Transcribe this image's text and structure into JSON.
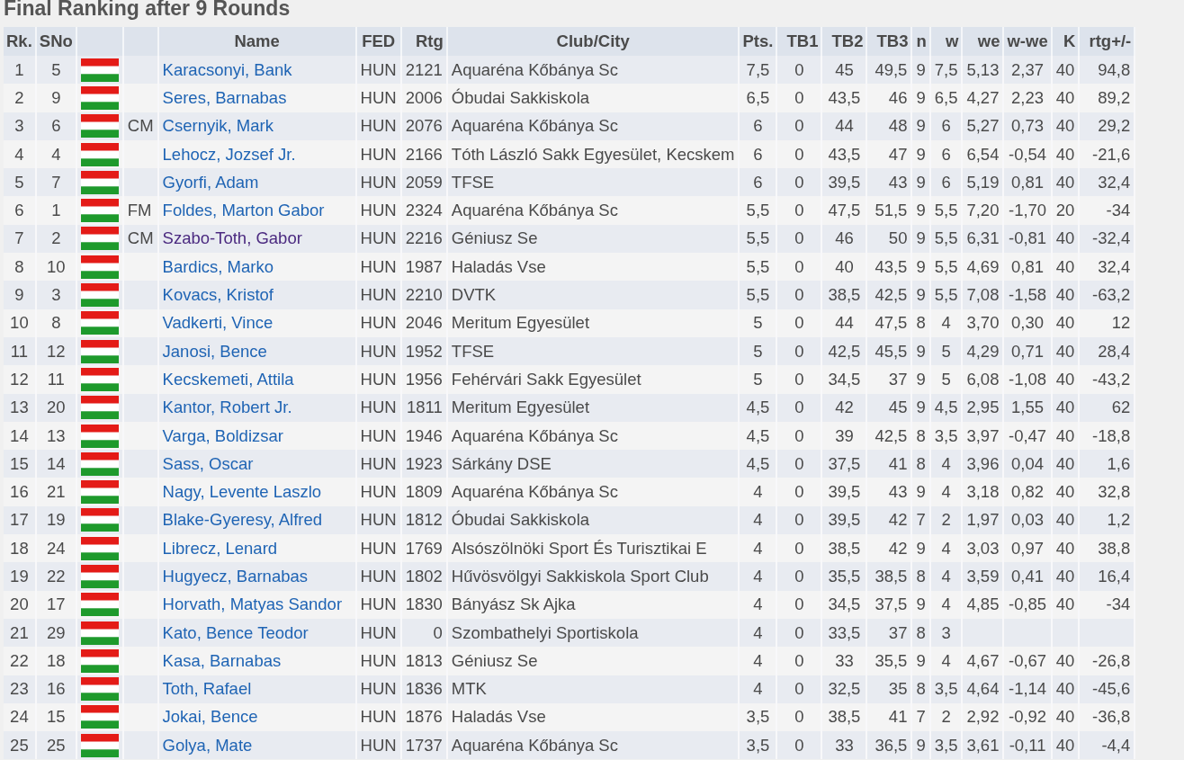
{
  "title": "Final Ranking after 9 Rounds",
  "table": {
    "columns": [
      "Rk.",
      "SNo",
      "Name",
      "FED",
      "Rtg",
      "Club/City",
      "Pts.",
      "TB1",
      "TB2",
      "TB3",
      "n",
      "w",
      "we",
      "w-we",
      "K",
      "rtg+/-"
    ],
    "rows": [
      {
        "rank": "1",
        "sno": "5",
        "name": "Karacsonyi, Bank",
        "visited": false,
        "fed": "HUN",
        "rtg": "2121",
        "club": "Aquaréna Kőbánya Sc",
        "pts": "7,5",
        "tb1": "0",
        "tb2": "45",
        "tb3": "49,5",
        "n": "9",
        "w": "7,5",
        "we": "5,13",
        "w_we": "2,37",
        "k": "40",
        "rtg_diff": "94,8"
      },
      {
        "rank": "2",
        "sno": "9",
        "name": "Seres, Barnabas",
        "visited": false,
        "fed": "HUN",
        "rtg": "2006",
        "club": "Óbudai Sakkiskola",
        "pts": "6,5",
        "tb1": "0",
        "tb2": "43,5",
        "tb3": "46",
        "n": "9",
        "w": "6,5",
        "we": "4,27",
        "w_we": "2,23",
        "k": "40",
        "rtg_diff": "89,2"
      },
      {
        "rank": "3",
        "sno": "6",
        "title": "CM",
        "name": "Csernyik, Mark",
        "visited": false,
        "fed": "HUN",
        "rtg": "2076",
        "club": "Aquaréna Kőbánya Sc",
        "pts": "6",
        "tb1": "0",
        "tb2": "44",
        "tb3": "48",
        "n": "9",
        "w": "6",
        "we": "5,27",
        "w_we": "0,73",
        "k": "40",
        "rtg_diff": "29,2"
      },
      {
        "rank": "4",
        "sno": "4",
        "name": "Lehocz, Jozsef Jr.",
        "visited": false,
        "fed": "HUN",
        "rtg": "2166",
        "club": "Tóth László Sakk Egyesület, Kecskem",
        "pts": "6",
        "tb1": "0",
        "tb2": "43,5",
        "tb3": "47",
        "n": "9",
        "w": "6",
        "we": "6,54",
        "w_we": "-0,54",
        "k": "40",
        "rtg_diff": "-21,6"
      },
      {
        "rank": "5",
        "sno": "7",
        "name": "Gyorfi, Adam",
        "visited": false,
        "fed": "HUN",
        "rtg": "2059",
        "club": "TFSE",
        "pts": "6",
        "tb1": "0",
        "tb2": "39,5",
        "tb3": "43",
        "n": "9",
        "w": "6",
        "we": "5,19",
        "w_we": "0,81",
        "k": "40",
        "rtg_diff": "32,4"
      },
      {
        "rank": "6",
        "sno": "1",
        "title": "FM",
        "name": "Foldes, Marton Gabor",
        "visited": false,
        "fed": "HUN",
        "rtg": "2324",
        "club": "Aquaréna Kőbánya Sc",
        "pts": "5,5",
        "tb1": "0",
        "tb2": "47,5",
        "tb3": "51,5",
        "n": "9",
        "w": "5,5",
        "we": "7,20",
        "w_we": "-1,70",
        "k": "20",
        "rtg_diff": "-34"
      },
      {
        "rank": "7",
        "sno": "2",
        "title": "CM",
        "name": "Szabo-Toth, Gabor",
        "visited": true,
        "fed": "HUN",
        "rtg": "2216",
        "club": "Géniusz Se",
        "pts": "5,5",
        "tb1": "0",
        "tb2": "46",
        "tb3": "50",
        "n": "9",
        "w": "5,5",
        "we": "6,31",
        "w_we": "-0,81",
        "k": "40",
        "rtg_diff": "-32,4"
      },
      {
        "rank": "8",
        "sno": "10",
        "name": "Bardics, Marko",
        "visited": false,
        "fed": "HUN",
        "rtg": "1987",
        "club": "Haladás Vse",
        "pts": "5,5",
        "tb1": "0",
        "tb2": "40",
        "tb3": "43,5",
        "n": "9",
        "w": "5,5",
        "we": "4,69",
        "w_we": "0,81",
        "k": "40",
        "rtg_diff": "32,4"
      },
      {
        "rank": "9",
        "sno": "3",
        "name": "Kovacs, Kristof",
        "visited": false,
        "fed": "HUN",
        "rtg": "2210",
        "club": "DVTK",
        "pts": "5,5",
        "tb1": "0",
        "tb2": "38,5",
        "tb3": "42,5",
        "n": "9",
        "w": "5,5",
        "we": "7,08",
        "w_we": "-1,58",
        "k": "40",
        "rtg_diff": "-63,2"
      },
      {
        "rank": "10",
        "sno": "8",
        "name": "Vadkerti, Vince",
        "visited": false,
        "fed": "HUN",
        "rtg": "2046",
        "club": "Meritum Egyesület",
        "pts": "5",
        "tb1": "0",
        "tb2": "44",
        "tb3": "47,5",
        "n": "8",
        "w": "4",
        "we": "3,70",
        "w_we": "0,30",
        "k": "40",
        "rtg_diff": "12"
      },
      {
        "rank": "11",
        "sno": "12",
        "name": "Janosi, Bence",
        "visited": false,
        "fed": "HUN",
        "rtg": "1952",
        "club": "TFSE",
        "pts": "5",
        "tb1": "0",
        "tb2": "42,5",
        "tb3": "45,5",
        "n": "9",
        "w": "5",
        "we": "4,29",
        "w_we": "0,71",
        "k": "40",
        "rtg_diff": "28,4"
      },
      {
        "rank": "12",
        "sno": "11",
        "name": "Kecskemeti, Attila",
        "visited": false,
        "fed": "HUN",
        "rtg": "1956",
        "club": "Fehérvári Sakk Egyesület",
        "pts": "5",
        "tb1": "0",
        "tb2": "34,5",
        "tb3": "37",
        "n": "9",
        "w": "5",
        "we": "6,08",
        "w_we": "-1,08",
        "k": "40",
        "rtg_diff": "-43,2"
      },
      {
        "rank": "13",
        "sno": "20",
        "name": "Kantor, Robert Jr.",
        "visited": false,
        "fed": "HUN",
        "rtg": "1811",
        "club": "Meritum Egyesület",
        "pts": "4,5",
        "tb1": "0",
        "tb2": "42",
        "tb3": "45",
        "n": "9",
        "w": "4,5",
        "we": "2,95",
        "w_we": "1,55",
        "k": "40",
        "rtg_diff": "62"
      },
      {
        "rank": "14",
        "sno": "13",
        "name": "Varga, Boldizsar",
        "visited": false,
        "fed": "HUN",
        "rtg": "1946",
        "club": "Aquaréna Kőbánya Sc",
        "pts": "4,5",
        "tb1": "0",
        "tb2": "39",
        "tb3": "42,5",
        "n": "8",
        "w": "3,5",
        "we": "3,97",
        "w_we": "-0,47",
        "k": "40",
        "rtg_diff": "-18,8"
      },
      {
        "rank": "15",
        "sno": "14",
        "name": "Sass, Oscar",
        "visited": false,
        "fed": "HUN",
        "rtg": "1923",
        "club": "Sárkány DSE",
        "pts": "4,5",
        "tb1": "0",
        "tb2": "37,5",
        "tb3": "41",
        "n": "8",
        "w": "4",
        "we": "3,96",
        "w_we": "0,04",
        "k": "40",
        "rtg_diff": "1,6"
      },
      {
        "rank": "16",
        "sno": "21",
        "name": "Nagy, Levente Laszlo",
        "visited": false,
        "fed": "HUN",
        "rtg": "1809",
        "club": "Aquaréna Kőbánya Sc",
        "pts": "4",
        "tb1": "0",
        "tb2": "39,5",
        "tb3": "43",
        "n": "9",
        "w": "4",
        "we": "3,18",
        "w_we": "0,82",
        "k": "40",
        "rtg_diff": "32,8"
      },
      {
        "rank": "17",
        "sno": "19",
        "name": "Blake-Gyeresy, Alfred",
        "visited": false,
        "fed": "HUN",
        "rtg": "1812",
        "club": "Óbudai Sakkiskola",
        "pts": "4",
        "tb1": "0",
        "tb2": "39,5",
        "tb3": "42",
        "n": "7",
        "w": "2",
        "we": "1,97",
        "w_we": "0,03",
        "k": "40",
        "rtg_diff": "1,2"
      },
      {
        "rank": "18",
        "sno": "24",
        "name": "Librecz, Lenard",
        "visited": false,
        "fed": "HUN",
        "rtg": "1769",
        "club": "Alsószölnöki Sport És Turisztikai E",
        "pts": "4",
        "tb1": "0",
        "tb2": "38,5",
        "tb3": "42",
        "n": "9",
        "w": "4",
        "we": "3,03",
        "w_we": "0,97",
        "k": "40",
        "rtg_diff": "38,8"
      },
      {
        "rank": "19",
        "sno": "22",
        "name": "Hugyecz, Barnabas",
        "visited": false,
        "fed": "HUN",
        "rtg": "1802",
        "club": "Hűvösvölgyi Sakkiskola Sport Club",
        "pts": "4",
        "tb1": "0",
        "tb2": "35,5",
        "tb3": "38,5",
        "n": "8",
        "w": "4",
        "we": "3,59",
        "w_we": "0,41",
        "k": "40",
        "rtg_diff": "16,4"
      },
      {
        "rank": "20",
        "sno": "17",
        "name": "Horvath, Matyas Sandor",
        "visited": false,
        "fed": "HUN",
        "rtg": "1830",
        "club": "Bányász Sk Ajka",
        "pts": "4",
        "tb1": "0",
        "tb2": "34,5",
        "tb3": "37,5",
        "n": "9",
        "w": "4",
        "we": "4,85",
        "w_we": "-0,85",
        "k": "40",
        "rtg_diff": "-34"
      },
      {
        "rank": "21",
        "sno": "29",
        "name": "Kato, Bence Teodor",
        "visited": false,
        "fed": "HUN",
        "rtg": "0",
        "club": "Szombathelyi Sportiskola",
        "pts": "4",
        "tb1": "0",
        "tb2": "33,5",
        "tb3": "37",
        "n": "8",
        "w": "3"
      },
      {
        "rank": "22",
        "sno": "18",
        "name": "Kasa, Barnabas",
        "visited": false,
        "fed": "HUN",
        "rtg": "1813",
        "club": "Géniusz Se",
        "pts": "4",
        "tb1": "0",
        "tb2": "33",
        "tb3": "35,5",
        "n": "9",
        "w": "4",
        "we": "4,67",
        "w_we": "-0,67",
        "k": "40",
        "rtg_diff": "-26,8"
      },
      {
        "rank": "23",
        "sno": "16",
        "name": "Toth, Rafael",
        "visited": false,
        "fed": "HUN",
        "rtg": "1836",
        "club": "MTK",
        "pts": "4",
        "tb1": "0",
        "tb2": "32,5",
        "tb3": "35",
        "n": "8",
        "w": "3,5",
        "we": "4,64",
        "w_we": "-1,14",
        "k": "40",
        "rtg_diff": "-45,6"
      },
      {
        "rank": "24",
        "sno": "15",
        "name": "Jokai, Bence",
        "visited": false,
        "fed": "HUN",
        "rtg": "1876",
        "club": "Haladás Vse",
        "pts": "3,5",
        "tb1": "0",
        "tb2": "38,5",
        "tb3": "41",
        "n": "7",
        "w": "2",
        "we": "2,92",
        "w_we": "-0,92",
        "k": "40",
        "rtg_diff": "-36,8"
      },
      {
        "rank": "25",
        "sno": "25",
        "name": "Golya, Mate",
        "visited": false,
        "fed": "HUN",
        "rtg": "1737",
        "club": "Aquaréna Kőbánya Sc",
        "pts": "3,5",
        "tb1": "0",
        "tb2": "33",
        "tb3": "36,5",
        "n": "9",
        "w": "3,5",
        "we": "3,61",
        "w_we": "-0,11",
        "k": "40",
        "rtg_diff": "-4,4"
      }
    ]
  }
}
